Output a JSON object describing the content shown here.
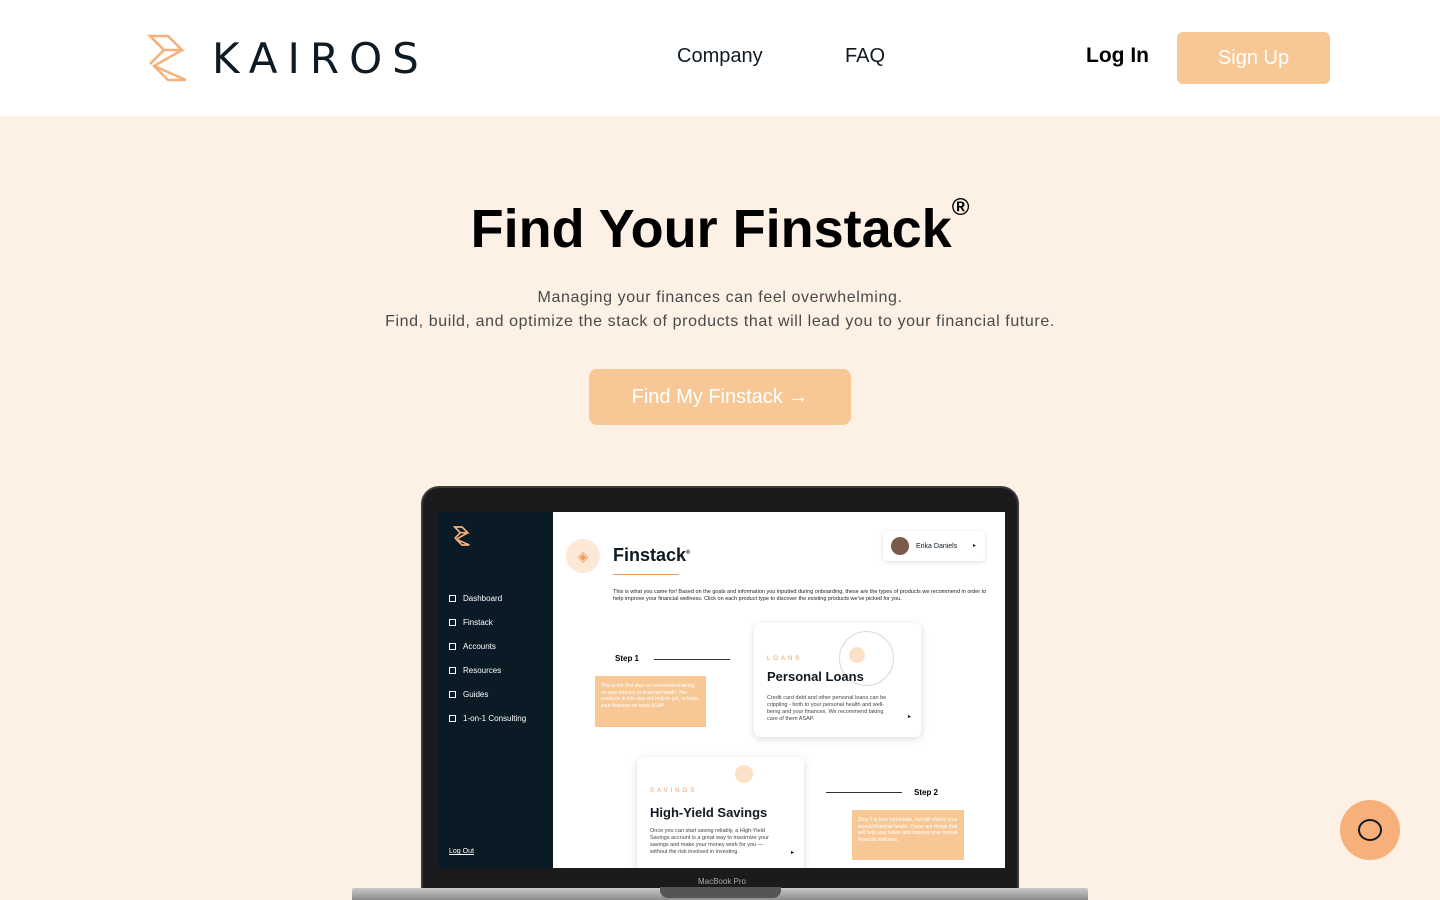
{
  "header": {
    "brand": "KAIROS",
    "nav": [
      "Company",
      "FAQ"
    ],
    "login_label": "Log In",
    "signup_label": "Sign Up"
  },
  "hero": {
    "title": "Find Your Finstack",
    "title_mark": "®",
    "subtitle_line1": "Managing your finances can feel overwhelming.",
    "subtitle_line2": "Find, build, and optimize the stack of products that will lead you to your financial future.",
    "cta_label": "Find My Finstack →"
  },
  "device": {
    "label": "MacBook Pro",
    "sidebar_items": [
      "Dashboard",
      "Finstack",
      "Accounts",
      "Resources",
      "Guides",
      "1-on-1 Consulting"
    ],
    "logout_label": "Log Out",
    "page_title": "Finstack",
    "page_title_mark": "®",
    "user_name": "Erika Daniels",
    "intro_text": "This is what you came for! Based on the goals and information you inputted during onboarding, these are the types of products we recommend in order to help improve your financial wellness. Click on each product type to discover the existing products we've picked for you.",
    "step1_label": "Step 1",
    "step1_note": "This is the first step we recommend taking on your journey to financial health. The products in this step will help to get, or keep, your finances on track ASAP.",
    "step2_label": "Step 2",
    "step2_note": "Step 2 is less immediate, but still vital to your overall financial health. These are things that will help your future and improve your overall financial wellness.",
    "card1": {
      "category": "LOANS",
      "title": "Personal Loans",
      "body": "Credit card debt and other personal loans can be crippling - both to your personal health and well-being and your finances. We recommend taking care of them ASAP."
    },
    "card2": {
      "category": "SAVINGS",
      "title": "High-Yield Savings",
      "body": "Once you can start saving reliably, a High-Yield Savings account is a great way to maximize your savings and make your money work for you — without the risk involved in investing."
    }
  },
  "colors": {
    "accent": "#f7c896",
    "hero_bg": "#fdf0e4",
    "dark": "#0b1b26",
    "orange": "#e79c5c"
  },
  "icons": {
    "help": "chat-bubble-icon"
  }
}
